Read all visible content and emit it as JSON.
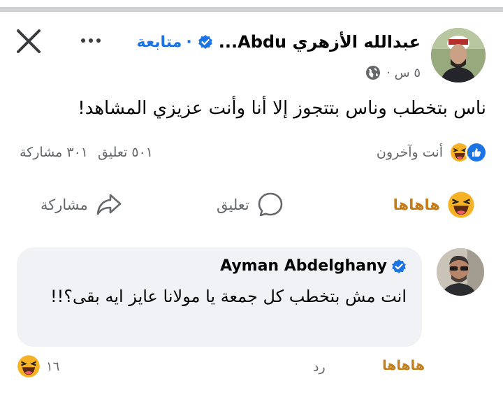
{
  "post": {
    "author": "عبدالله الأزهري Abdu...",
    "follow_sep": "·",
    "follow_label": "متابعة",
    "time": "٥ س ·",
    "text": "ناس بتخطب وناس بتتجوز إلا أنا وأنت عزيزي المشاهد!",
    "reactions_text": "أنت وآخرون",
    "comments_count": "٥٠١ تعليق",
    "shares_count": "٣٠١ مشاركة"
  },
  "actions": {
    "haha_label": "هاهاها",
    "comment_label": "تعليق",
    "share_label": "مشاركة"
  },
  "comment": {
    "author": "Ayman Abdelghany",
    "text": "انت مش بتخطب كل جمعة يا مولانا عايز ايه بقى؟!!",
    "haha_label": "هاهاها",
    "reply_label": "رد",
    "reaction_count": "١٦"
  },
  "icons": {
    "close": "close-icon",
    "more": "more-icon",
    "verified": "verified-badge-icon",
    "globe": "globe-icon",
    "haha": "haha-emoji-icon",
    "like": "like-icon",
    "comment": "comment-icon",
    "share": "share-icon"
  },
  "colors": {
    "accent": "#1b74e4",
    "haha": "#c47c16",
    "muted": "#65676b",
    "bubble": "#f0f2f5"
  }
}
